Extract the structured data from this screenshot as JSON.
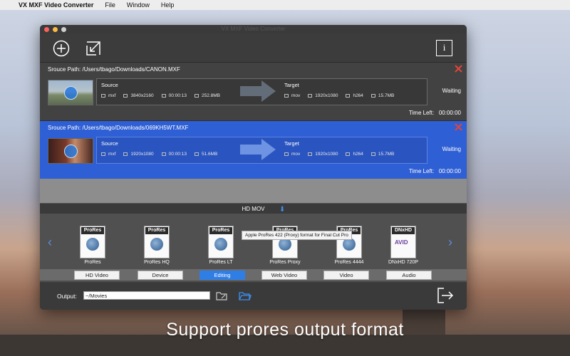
{
  "menubar": {
    "apple": "",
    "app_name": "VX MXF Video Converter",
    "items": [
      "File",
      "Window",
      "Help"
    ]
  },
  "window": {
    "title": "VX MXF Video Converter"
  },
  "toolbar": {
    "add_icon": "plus-circle-icon",
    "import_icon": "import-arrow-icon",
    "info_icon": "info-icon",
    "info_label": "i"
  },
  "jobs": [
    {
      "path_label": "Srouce Path:",
      "path": "/Users/tbago/Downloads/CANON.MXF",
      "source_label": "Source",
      "source": {
        "format": "mxf",
        "resolution": "3840x2160",
        "duration": "00:00:13",
        "size": "252.8MB"
      },
      "target_label": "Target",
      "target": {
        "format": "mov",
        "resolution": "1920x1080",
        "codec": "h264",
        "size": "15.7MB"
      },
      "status": "Waiting",
      "time_left_label": "Time Left:",
      "time_left": "00:00:00",
      "selected": false
    },
    {
      "path_label": "Srouce Path:",
      "path": "/Users/tbago/Downloads/069KH5WT.MXF",
      "source_label": "Source",
      "source": {
        "format": "mxf",
        "resolution": "1920x1080",
        "duration": "00:00:13",
        "size": "51.6MB"
      },
      "target_label": "Target",
      "target": {
        "format": "mov",
        "resolution": "1920x1080",
        "codec": "h264",
        "size": "15.7MB"
      },
      "status": "Waiting",
      "time_left_label": "Time Left:",
      "time_left": "00:00:00",
      "selected": true
    }
  ],
  "format_bar": {
    "label": "HD MOV"
  },
  "formats": [
    {
      "badge": "ProRes",
      "label": "ProRes"
    },
    {
      "badge": "ProRes",
      "label": "ProRes HQ"
    },
    {
      "badge": "ProRes",
      "label": "ProRes LT"
    },
    {
      "badge": "ProRes",
      "label": "ProRes Proxy"
    },
    {
      "badge": "ProRes",
      "label": "ProRes 4444"
    },
    {
      "badge": "DNxHD",
      "label": "DNxHD 720P"
    }
  ],
  "tooltip": "Apple ProRes 422 (Proxy) format for Final Cut Pro",
  "categories": [
    {
      "label": "HD Video",
      "active": false
    },
    {
      "label": "Device",
      "active": false
    },
    {
      "label": "Editing",
      "active": true
    },
    {
      "label": "Web Video",
      "active": false
    },
    {
      "label": "Video",
      "active": false
    },
    {
      "label": "Audio",
      "active": false
    }
  ],
  "output": {
    "label": "Output:",
    "value": "~/Movies"
  },
  "caption": "Support prores output format",
  "colors": {
    "selected_job": "#2f5fd4",
    "accent": "#2f7ee6",
    "close_x": "#e0453a",
    "traffic_red": "#fc605b",
    "traffic_yellow": "#fdbc40",
    "traffic_green": "#d0d0d0"
  }
}
